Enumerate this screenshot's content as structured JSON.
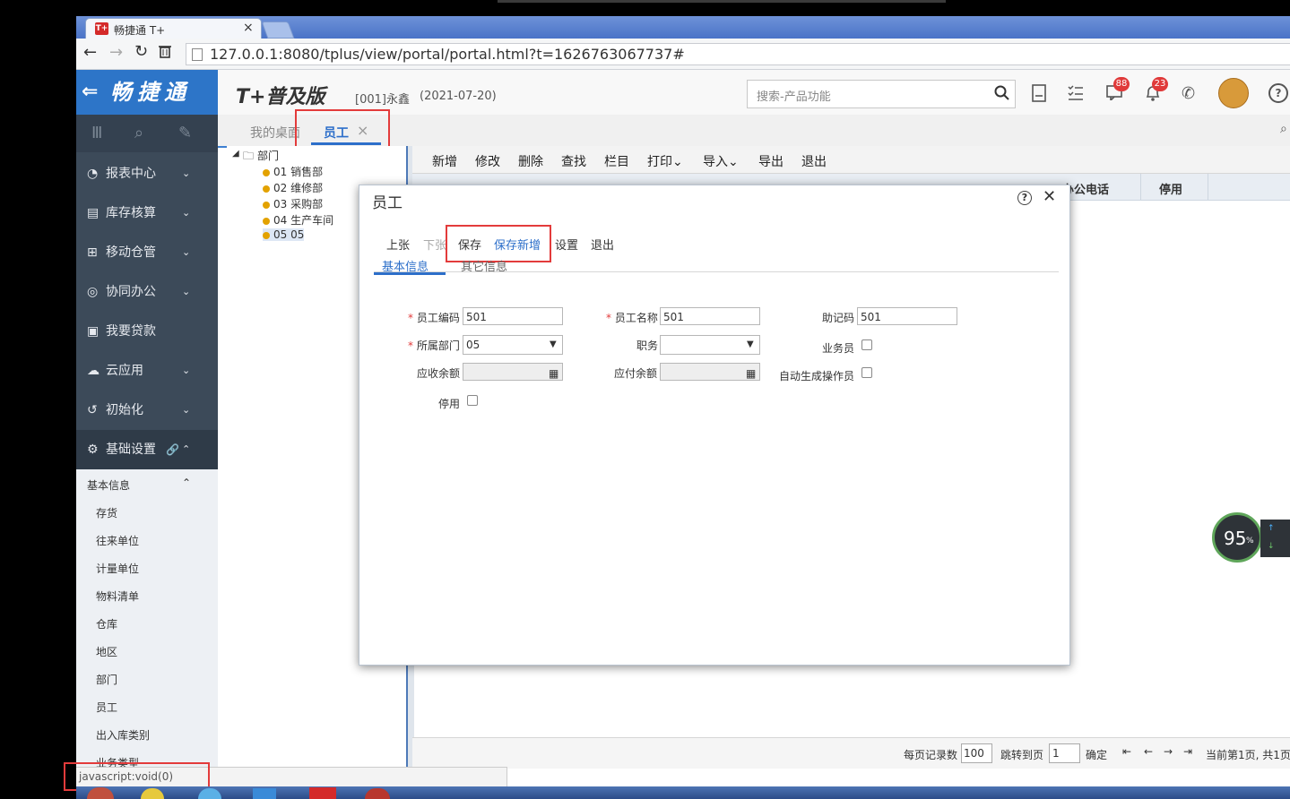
{
  "browser": {
    "tab_title": "畅捷通 T+",
    "tab_close": "×",
    "url": "127.0.0.1:8080/tplus/view/portal/portal.html?t=1626763067737#"
  },
  "header": {
    "logo_arrow": "⇐",
    "logo": "畅捷通",
    "product": "T+普及版",
    "account": "[001]永鑫",
    "date": "(2021-07-20)",
    "search_placeholder": "搜索-产品功能",
    "badge_messages": "88",
    "badge_notifications": "23"
  },
  "sidebar": {
    "items": [
      {
        "label": "报表中心",
        "chevron": "⌄"
      },
      {
        "label": "库存核算",
        "chevron": "⌄"
      },
      {
        "label": "移动仓管",
        "chevron": "⌄"
      },
      {
        "label": "协同办公",
        "chevron": "⌄"
      },
      {
        "label": "我要贷款",
        "chevron": ""
      },
      {
        "label": "云应用",
        "chevron": "⌄"
      },
      {
        "label": "初始化",
        "chevron": "⌄"
      },
      {
        "label": "基础设置",
        "chevron": "⌃"
      }
    ],
    "group_title": "基本信息",
    "sub_items": [
      "存货",
      "往来单位",
      "计量单位",
      "物料清单",
      "仓库",
      "地区",
      "部门",
      "员工",
      "出入库类别",
      "业务类型"
    ]
  },
  "tabs": {
    "home": "我的桌面",
    "employee": "员工",
    "close": "×"
  },
  "tree": {
    "root": "部门",
    "items": [
      "01 销售部",
      "02 维修部",
      "03 采购部",
      "04 生产车间",
      "05 05"
    ]
  },
  "list_toolbar": [
    "新增",
    "修改",
    "删除",
    "查找",
    "栏目",
    "打印⌄",
    "导入⌄",
    "导出",
    "退出"
  ],
  "grid_visible_headers": {
    "phone": "办公电话",
    "disabled": "停用"
  },
  "pager": {
    "per_page_label": "每页记录数",
    "per_page": "100",
    "goto_label": "跳转到页",
    "goto": "1",
    "confirm": "确定",
    "status": "当前第1页, 共1页"
  },
  "modal": {
    "title": "员工",
    "help": "?",
    "close": "✕",
    "toolbar": {
      "prev": "上张",
      "next": "下张",
      "save": "保存",
      "save_new": "保存新增",
      "settings": "设置",
      "exit": "退出"
    },
    "tabs": {
      "basic": "基本信息",
      "other": "其它信息"
    },
    "fields": {
      "code_label": "员工编码",
      "code_value": "501",
      "name_label": "员工名称",
      "name_value": "501",
      "mnemonic_label": "助记码",
      "mnemonic_value": "501",
      "dept_label": "所属部门",
      "dept_value": "05",
      "position_label": "职务",
      "position_value": "",
      "salesman_label": "业务员",
      "receivable_label": "应收余额",
      "payable_label": "应付余额",
      "auto_operator_label": "自动生成操作员",
      "disabled_label": "停用"
    }
  },
  "status_bar": "javascript:void(0)",
  "perf_widget": {
    "value": "95",
    "unit": "%"
  },
  "colors": {
    "brand_blue": "#2d75c8",
    "sidebar": "#3c4a59",
    "highlight_red": "#e33b3b",
    "link_blue": "#2d6fca"
  }
}
